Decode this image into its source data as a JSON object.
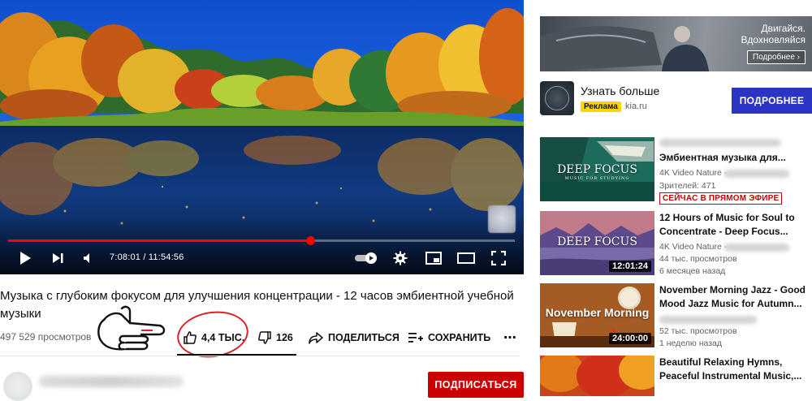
{
  "player": {
    "time": "7:08:01 / 11:54:56",
    "progress": 0.596
  },
  "video": {
    "title": "Музыка с глубоким фокусом для улучшения концентрации - 12 часов эмбиентной учебной музыки",
    "views": "497 529 просмотров",
    "likes": "4,4 ТЫС.",
    "dislikes": "126",
    "share_label": "ПОДЕЛИТЬСЯ",
    "save_label": "СОХРАНИТЬ",
    "more_label": "⋯"
  },
  "channel": {
    "subscribe_label": "ПОДПИСАТЬСЯ"
  },
  "ad": {
    "tagline_line1": "Двигайся.",
    "tagline_line2": "Вдохновляйся",
    "banner_button": "Подробнее ›",
    "title": "Узнать больше",
    "badge": "Реклама",
    "domain": "kia.ru",
    "cta": "ПОДРОБНЕЕ"
  },
  "recommendations": [
    {
      "title_line1": "Эмбиентная музыка для...",
      "channel": "4K Video Nature -",
      "meta": "Зрителей: 471",
      "live_badge": "СЕЙЧАС В ПРЯМОМ ЭФИРЕ",
      "thumb_text": "DEEP FOCUS",
      "thumb_subtext": "MUSIC FOR STUDYING"
    },
    {
      "title_line1": "12 Hours of Music for Soul to",
      "title_line2": "Concentrate - Deep Focus...",
      "channel": "4K Video Nature -",
      "meta1": "44 тыс. просмотров",
      "meta2": "6 месяцев назад",
      "duration": "12:01:24",
      "thumb_text": "DEEP FOCUS"
    },
    {
      "title_line1": "November Morning Jazz - Good",
      "title_line2": "Mood Jazz Music for Autumn...",
      "meta1": "52 тыс. просмотров",
      "meta2": "1 неделю назад",
      "duration": "24:00:00",
      "thumb_text": "November Morning"
    },
    {
      "title_line1": "Beautiful Relaxing Hymns,",
      "title_line2": "Peaceful Instrumental Music,..."
    }
  ],
  "colors": {
    "progress": "#ff0000",
    "subscribe": "#cc0000",
    "ad_cta": "#2c35c3",
    "ad_badge": "#fbd500",
    "annotation_ring": "#d8232a"
  }
}
